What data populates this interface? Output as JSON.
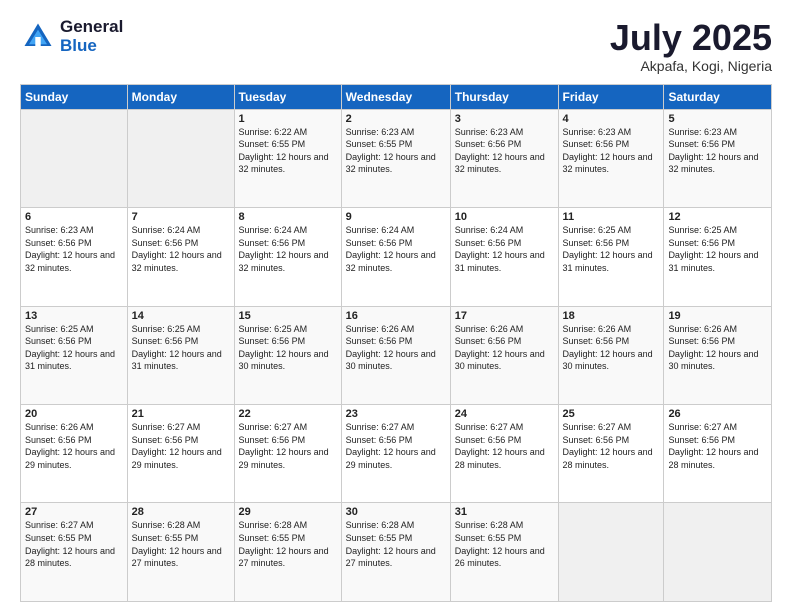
{
  "header": {
    "logo_general": "General",
    "logo_blue": "Blue",
    "month_title": "July 2025",
    "location": "Akpafa, Kogi, Nigeria"
  },
  "days_of_week": [
    "Sunday",
    "Monday",
    "Tuesday",
    "Wednesday",
    "Thursday",
    "Friday",
    "Saturday"
  ],
  "weeks": [
    [
      {
        "day": "",
        "sunrise": "",
        "sunset": "",
        "daylight": ""
      },
      {
        "day": "",
        "sunrise": "",
        "sunset": "",
        "daylight": ""
      },
      {
        "day": "1",
        "sunrise": "Sunrise: 6:22 AM",
        "sunset": "Sunset: 6:55 PM",
        "daylight": "Daylight: 12 hours and 32 minutes."
      },
      {
        "day": "2",
        "sunrise": "Sunrise: 6:23 AM",
        "sunset": "Sunset: 6:55 PM",
        "daylight": "Daylight: 12 hours and 32 minutes."
      },
      {
        "day": "3",
        "sunrise": "Sunrise: 6:23 AM",
        "sunset": "Sunset: 6:56 PM",
        "daylight": "Daylight: 12 hours and 32 minutes."
      },
      {
        "day": "4",
        "sunrise": "Sunrise: 6:23 AM",
        "sunset": "Sunset: 6:56 PM",
        "daylight": "Daylight: 12 hours and 32 minutes."
      },
      {
        "day": "5",
        "sunrise": "Sunrise: 6:23 AM",
        "sunset": "Sunset: 6:56 PM",
        "daylight": "Daylight: 12 hours and 32 minutes."
      }
    ],
    [
      {
        "day": "6",
        "sunrise": "Sunrise: 6:23 AM",
        "sunset": "Sunset: 6:56 PM",
        "daylight": "Daylight: 12 hours and 32 minutes."
      },
      {
        "day": "7",
        "sunrise": "Sunrise: 6:24 AM",
        "sunset": "Sunset: 6:56 PM",
        "daylight": "Daylight: 12 hours and 32 minutes."
      },
      {
        "day": "8",
        "sunrise": "Sunrise: 6:24 AM",
        "sunset": "Sunset: 6:56 PM",
        "daylight": "Daylight: 12 hours and 32 minutes."
      },
      {
        "day": "9",
        "sunrise": "Sunrise: 6:24 AM",
        "sunset": "Sunset: 6:56 PM",
        "daylight": "Daylight: 12 hours and 32 minutes."
      },
      {
        "day": "10",
        "sunrise": "Sunrise: 6:24 AM",
        "sunset": "Sunset: 6:56 PM",
        "daylight": "Daylight: 12 hours and 31 minutes."
      },
      {
        "day": "11",
        "sunrise": "Sunrise: 6:25 AM",
        "sunset": "Sunset: 6:56 PM",
        "daylight": "Daylight: 12 hours and 31 minutes."
      },
      {
        "day": "12",
        "sunrise": "Sunrise: 6:25 AM",
        "sunset": "Sunset: 6:56 PM",
        "daylight": "Daylight: 12 hours and 31 minutes."
      }
    ],
    [
      {
        "day": "13",
        "sunrise": "Sunrise: 6:25 AM",
        "sunset": "Sunset: 6:56 PM",
        "daylight": "Daylight: 12 hours and 31 minutes."
      },
      {
        "day": "14",
        "sunrise": "Sunrise: 6:25 AM",
        "sunset": "Sunset: 6:56 PM",
        "daylight": "Daylight: 12 hours and 31 minutes."
      },
      {
        "day": "15",
        "sunrise": "Sunrise: 6:25 AM",
        "sunset": "Sunset: 6:56 PM",
        "daylight": "Daylight: 12 hours and 30 minutes."
      },
      {
        "day": "16",
        "sunrise": "Sunrise: 6:26 AM",
        "sunset": "Sunset: 6:56 PM",
        "daylight": "Daylight: 12 hours and 30 minutes."
      },
      {
        "day": "17",
        "sunrise": "Sunrise: 6:26 AM",
        "sunset": "Sunset: 6:56 PM",
        "daylight": "Daylight: 12 hours and 30 minutes."
      },
      {
        "day": "18",
        "sunrise": "Sunrise: 6:26 AM",
        "sunset": "Sunset: 6:56 PM",
        "daylight": "Daylight: 12 hours and 30 minutes."
      },
      {
        "day": "19",
        "sunrise": "Sunrise: 6:26 AM",
        "sunset": "Sunset: 6:56 PM",
        "daylight": "Daylight: 12 hours and 30 minutes."
      }
    ],
    [
      {
        "day": "20",
        "sunrise": "Sunrise: 6:26 AM",
        "sunset": "Sunset: 6:56 PM",
        "daylight": "Daylight: 12 hours and 29 minutes."
      },
      {
        "day": "21",
        "sunrise": "Sunrise: 6:27 AM",
        "sunset": "Sunset: 6:56 PM",
        "daylight": "Daylight: 12 hours and 29 minutes."
      },
      {
        "day": "22",
        "sunrise": "Sunrise: 6:27 AM",
        "sunset": "Sunset: 6:56 PM",
        "daylight": "Daylight: 12 hours and 29 minutes."
      },
      {
        "day": "23",
        "sunrise": "Sunrise: 6:27 AM",
        "sunset": "Sunset: 6:56 PM",
        "daylight": "Daylight: 12 hours and 29 minutes."
      },
      {
        "day": "24",
        "sunrise": "Sunrise: 6:27 AM",
        "sunset": "Sunset: 6:56 PM",
        "daylight": "Daylight: 12 hours and 28 minutes."
      },
      {
        "day": "25",
        "sunrise": "Sunrise: 6:27 AM",
        "sunset": "Sunset: 6:56 PM",
        "daylight": "Daylight: 12 hours and 28 minutes."
      },
      {
        "day": "26",
        "sunrise": "Sunrise: 6:27 AM",
        "sunset": "Sunset: 6:56 PM",
        "daylight": "Daylight: 12 hours and 28 minutes."
      }
    ],
    [
      {
        "day": "27",
        "sunrise": "Sunrise: 6:27 AM",
        "sunset": "Sunset: 6:55 PM",
        "daylight": "Daylight: 12 hours and 28 minutes."
      },
      {
        "day": "28",
        "sunrise": "Sunrise: 6:28 AM",
        "sunset": "Sunset: 6:55 PM",
        "daylight": "Daylight: 12 hours and 27 minutes."
      },
      {
        "day": "29",
        "sunrise": "Sunrise: 6:28 AM",
        "sunset": "Sunset: 6:55 PM",
        "daylight": "Daylight: 12 hours and 27 minutes."
      },
      {
        "day": "30",
        "sunrise": "Sunrise: 6:28 AM",
        "sunset": "Sunset: 6:55 PM",
        "daylight": "Daylight: 12 hours and 27 minutes."
      },
      {
        "day": "31",
        "sunrise": "Sunrise: 6:28 AM",
        "sunset": "Sunset: 6:55 PM",
        "daylight": "Daylight: 12 hours and 26 minutes."
      },
      {
        "day": "",
        "sunrise": "",
        "sunset": "",
        "daylight": ""
      },
      {
        "day": "",
        "sunrise": "",
        "sunset": "",
        "daylight": ""
      }
    ]
  ]
}
